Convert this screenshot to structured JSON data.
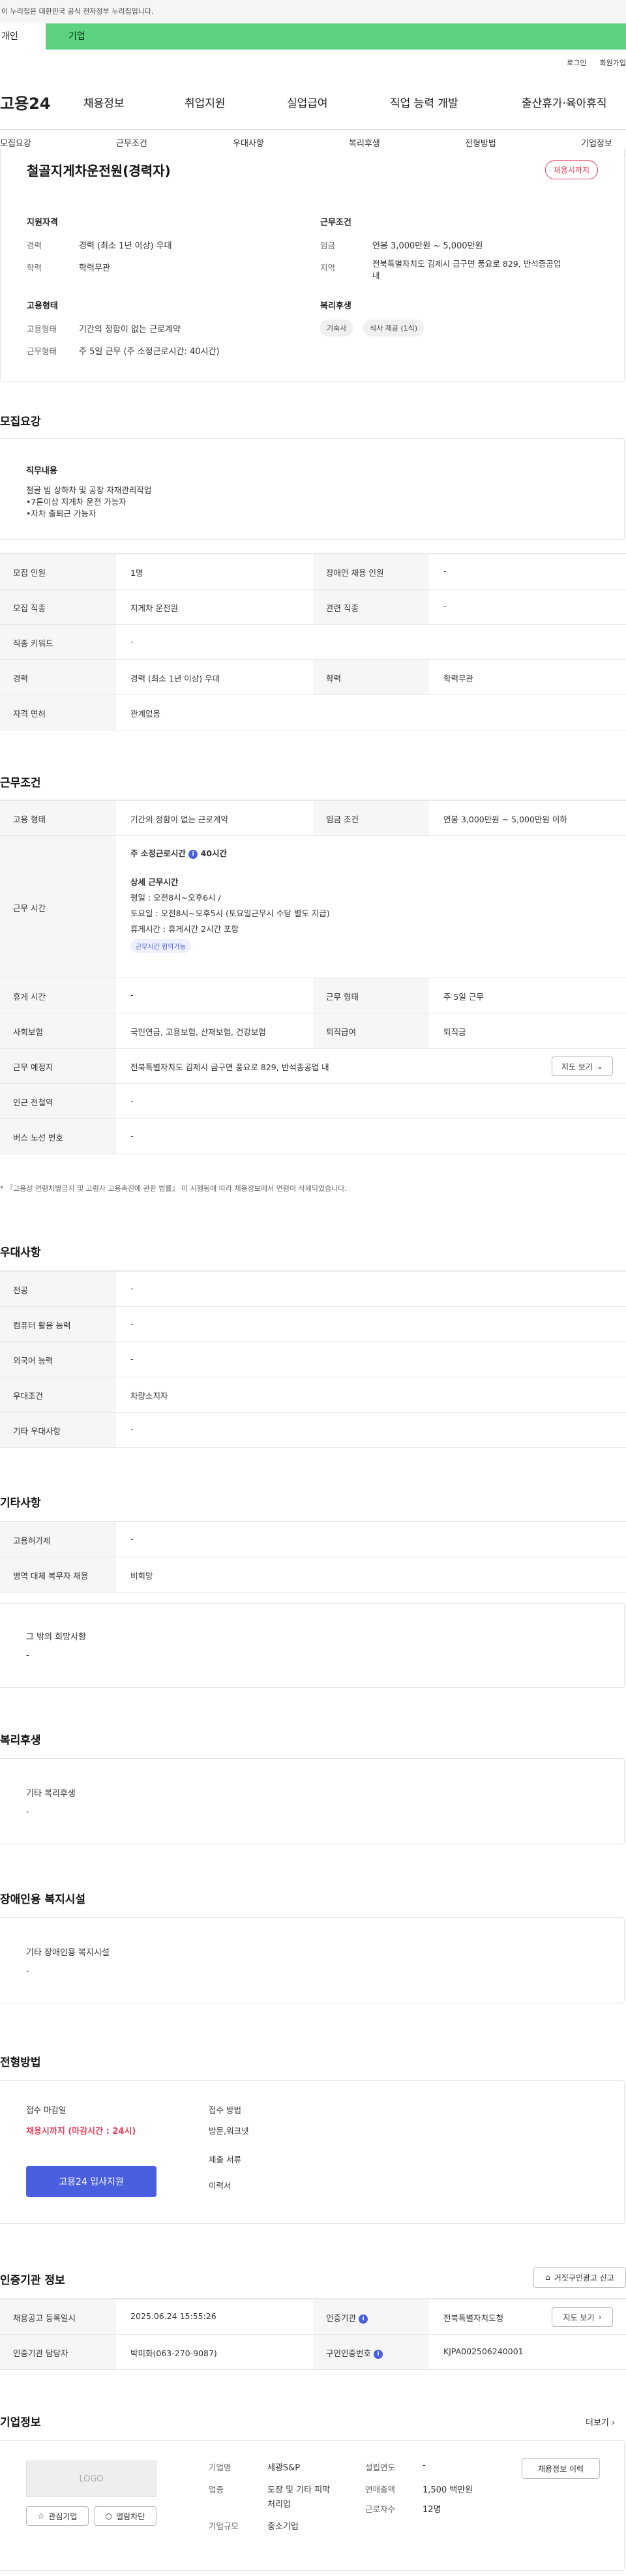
{
  "banner": {
    "text": "이 누리집은 대한민국 공식 전자정부 누리집입니다."
  },
  "audience": {
    "personal": "개인",
    "company": "기업"
  },
  "util": {
    "login": "로그인",
    "signup": "회원가입"
  },
  "gnb": {
    "logo": "고용24",
    "items": [
      "채용정보",
      "취업지원",
      "실업급여",
      "직업 능력 개발",
      "출산휴가·육아휴직"
    ]
  },
  "subnav": [
    "모집요강",
    "근무조건",
    "우대사항",
    "복리후생",
    "전형방법",
    "기업정보"
  ],
  "summary": {
    "title": "철골지게차운전원(경력자)",
    "badge": "채용시까지",
    "qual_title": "지원자격",
    "qual": [
      {
        "k": "경력",
        "v": "경력 (최소 1년 이상) 우대"
      },
      {
        "k": "학력",
        "v": "학력무관"
      }
    ],
    "emp_title": "고용형태",
    "emp": [
      {
        "k": "고용형태",
        "v": "기간의 정함이 없는 근로계약"
      },
      {
        "k": "근무형태",
        "v": "주 5일 근무 (주 소정근로시간: 40시간)"
      }
    ],
    "cond_title": "근무조건",
    "cond": [
      {
        "k": "임금",
        "v": "연봉 3,000만원 ~ 5,000만원"
      },
      {
        "k": "지역",
        "v": "전북특별자치도 김제시 금구면 풍요로 829, 반석종공업"
      },
      {
        "k": "",
        "v": "내"
      }
    ],
    "welfare_title": "복리후생",
    "welfare": [
      "기숙사",
      "식사 제공 (1식)"
    ]
  },
  "recruit": {
    "title": "모집요강",
    "duty_title": "직무내용",
    "duty_lines": [
      "철골 빔 상하차 및 공장 자재관리작업",
      "•7톤이상 지게차 운전 가능자",
      "•자차 출퇴근 가능자"
    ],
    "rows": [
      {
        "l1": "모집 인원",
        "v1": "1명",
        "l2": "장애인 채용 인원",
        "v2": "-"
      },
      {
        "l1": "모집 직종",
        "v1": "지게차 운전원",
        "l2": "관련 직종",
        "v2": "-"
      },
      {
        "l1": "직종 키워드",
        "v1": "-"
      },
      {
        "l1": "경력",
        "v1": "경력 (최소 1년 이상) 우대",
        "l2": "학력",
        "v2": "학력무관"
      },
      {
        "l1": "자격 면허",
        "v1": "관계없음"
      }
    ]
  },
  "work": {
    "title": "근무조건",
    "type_l": "고용 형태",
    "type_v": "기간의 정함이 없는 근로계약",
    "wage_l": "임금 조건",
    "wage_v": "연봉 3,000만원 ~ 5,000만원 이하",
    "hours_l": "근무 시간",
    "hours_main": "주 소정근로시간",
    "hours_val": "40시간",
    "detail_title": "상세 근무시간",
    "detail_lines": [
      "평일 : 오전8시~오후6시 /",
      "토요일 : 오전8시~오후5시 (토요일근무시 수당 별도 지급)",
      "휴게시간 : 휴게시간 2시간 포함"
    ],
    "flex_chip": "근무시간 협의가능",
    "rows": [
      {
        "l1": "휴게 시간",
        "v1": "-",
        "l2": "근무 형태",
        "v2": "주 5일 근무"
      },
      {
        "l1": "사회보험",
        "v1": "국민연금, 고용보험, 산재보험, 건강보험",
        "l2": "퇴직급여",
        "v2": "퇴직금"
      },
      {
        "l1": "근무 예정지",
        "v1": "전북특별자치도 김제시 금구면 풍요로 829, 반석종공업 내",
        "btn": "지도 보기"
      },
      {
        "l1": "인근 전철역",
        "v1": "-"
      },
      {
        "l1": "버스 노선 번호",
        "v1": "-"
      }
    ],
    "note": "* 『고용상 연령차별금지 및 고령자 고용촉진에 관한 법률』 이 시행됨에 따라 채용정보에서 연령이 삭제되었습니다."
  },
  "pref": {
    "title": "우대사항",
    "rows": [
      {
        "l": "전공",
        "v": "-"
      },
      {
        "l": "컴퓨터 활용 능력",
        "v": "-"
      },
      {
        "l": "외국어 능력",
        "v": "-"
      },
      {
        "l": "우대조건",
        "v": "차량소지자"
      },
      {
        "l": "기타 우대사항",
        "v": "-"
      }
    ]
  },
  "etc": {
    "title": "기타사항",
    "rows": [
      {
        "l": "고용허가제",
        "v": "-"
      },
      {
        "l": "병역 대체 복무자 채용",
        "v": "비희망"
      }
    ],
    "other_title": "그 밖의 희망사항",
    "other_v": "-"
  },
  "welfare": {
    "title": "복리후생",
    "box_title": "기타 복리후생",
    "box_v": "-"
  },
  "disabled": {
    "title": "장애인용 복지시설",
    "box_title": "기타 장애인용 복지시설",
    "box_v": "-"
  },
  "process": {
    "title": "전형방법",
    "deadline_l": "접수 마감일",
    "deadline_v": "채용시까지 (마감시간 : 24시)",
    "method_l": "접수 방법",
    "method_v": "방문,워크넷",
    "docs_l": "제출 서류",
    "docs_v": "이력서",
    "apply_btn": "고용24 입사지원"
  },
  "agency": {
    "title": "인증기관 정보",
    "report_btn": "거짓구인광고 신고",
    "rows": [
      {
        "l1": "채용공고 등록일시",
        "v1": "2025.06.24 15:55:26",
        "l2": "인증기관",
        "v2": "전북특별자치도청",
        "btn": "지도 보기"
      },
      {
        "l1": "인증기관 담당자",
        "v1": "박미화(063-270-9087)",
        "l2": "구인인증번호",
        "v2": "KJPA002506240001"
      }
    ]
  },
  "company": {
    "title": "기업정보",
    "more": "더보기",
    "logo": "LOGO",
    "fav_btn": "관심기업",
    "block_btn": "열람차단",
    "name_l": "기업명",
    "name_v": "세광S&P",
    "ind_l": "업종",
    "ind_v1": "도장 및 기타 피막",
    "ind_v2": "처리업",
    "size_l": "기업규모",
    "size_v": "중소기업",
    "year_l": "설립연도",
    "year_v": "-",
    "sales_l": "연매출액",
    "sales_v": "1,500 백만원",
    "emp_l": "근로자수",
    "emp_v": "12명",
    "history_btn": "채용정보 이력"
  }
}
